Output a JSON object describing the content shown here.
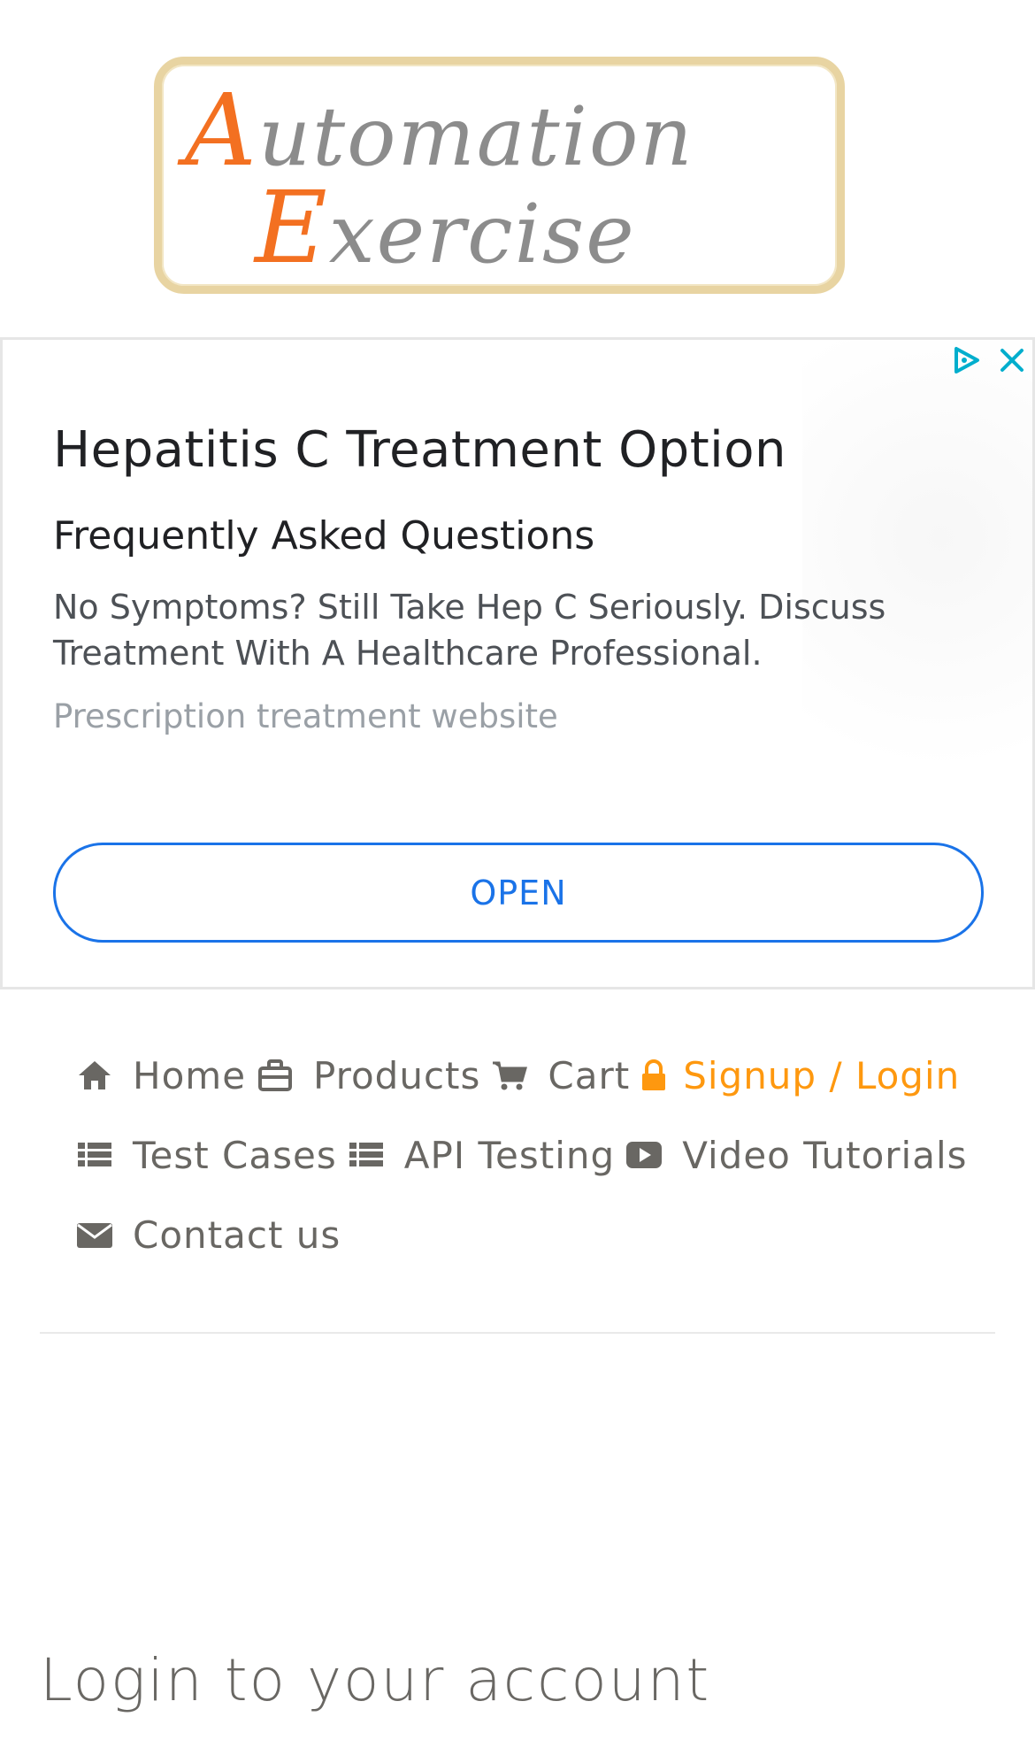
{
  "logo": {
    "line1_cap": "A",
    "line1_rest": "utomation",
    "line2_cap": "E",
    "line2_rest": "xercise",
    "brand_color": "#f37021"
  },
  "ad": {
    "title": "Hepatitis C Treatment Option",
    "subtitle": "Frequently Asked Questions",
    "description": "No Symptoms? Still Take Hep C Seriously. Discuss Treatment With A Healthcare Professional.",
    "source": "Prescription treatment website",
    "open_label": "OPEN",
    "accent": "#1a73e8",
    "icons": [
      "adchoices-icon",
      "close-icon"
    ]
  },
  "nav": {
    "items": [
      {
        "label": "Home",
        "icon": "home-icon"
      },
      {
        "label": "Products",
        "icon": "briefcase-icon"
      },
      {
        "label": "Cart",
        "icon": "cart-icon"
      },
      {
        "label": "Signup / Login",
        "icon": "lock-icon",
        "active": true
      },
      {
        "label": "Test Cases",
        "icon": "list-icon"
      },
      {
        "label": "API Testing",
        "icon": "list-icon"
      },
      {
        "label": "Video Tutorials",
        "icon": "youtube-play-icon"
      },
      {
        "label": "Contact us",
        "icon": "envelope-icon"
      }
    ],
    "active_color": "#fe980f"
  },
  "login": {
    "title": "Login to your account"
  }
}
